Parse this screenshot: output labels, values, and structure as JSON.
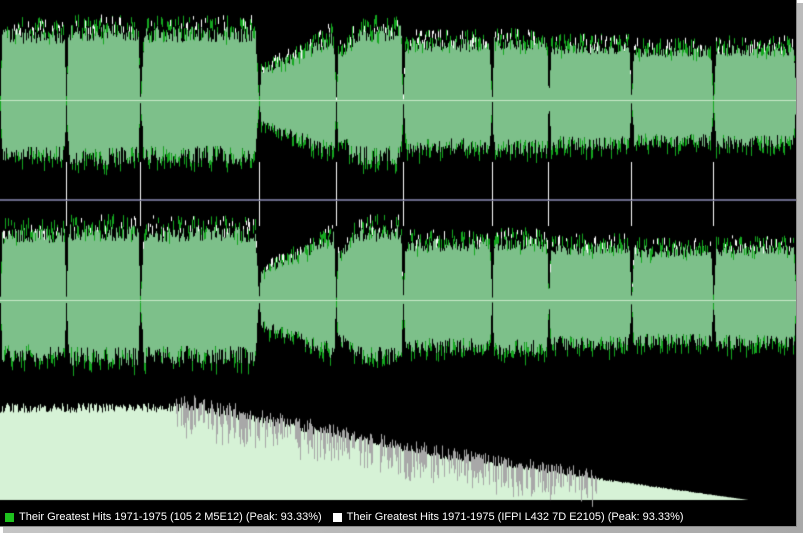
{
  "colors": {
    "background": "#000000",
    "track_a_fill": "#7dc08a",
    "track_a_peak": "#15a820",
    "track_b_peak": "#ffffff",
    "spectrum_fill": "#d6f2d6",
    "spectrum_peak": "#a8a8a8",
    "center_line": "#c8e8c8",
    "channel_divider": "#6a6a8a",
    "track_marker": "#ffffff"
  },
  "legend": {
    "items": [
      {
        "label": "Their Greatest Hits 1971-1975 (105 2 M5E12) (Peak: 93.33%)",
        "color": "#1ec21e"
      },
      {
        "label": "Their Greatest Hits 1971-1975 (IFPI L432 7D E2105) (Peak: 93.33%)",
        "color": "#ffffff"
      }
    ]
  },
  "chart_data": {
    "type": "area",
    "channels": [
      "left",
      "right"
    ],
    "track_boundaries_fraction": [
      0.083,
      0.176,
      0.325,
      0.422,
      0.506,
      0.618,
      0.689,
      0.793,
      0.896
    ],
    "peak_level_percent": 93.33
  }
}
